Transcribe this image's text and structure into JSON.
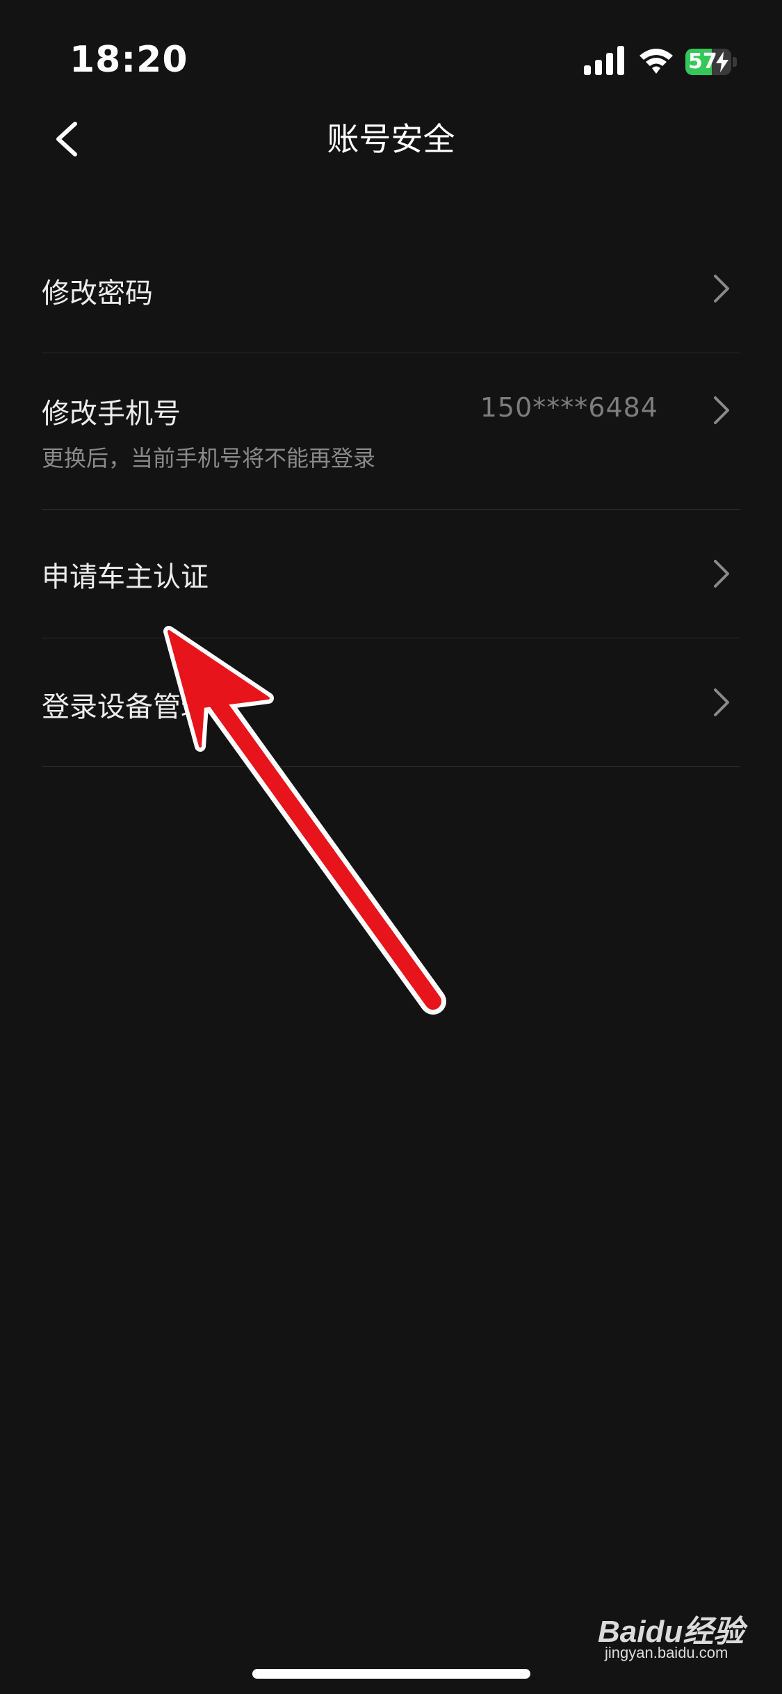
{
  "status_bar": {
    "time": "18:20",
    "battery_level": "57",
    "battery_fraction": 0.57,
    "battery_color": "#34c759",
    "icons": [
      "signal-icon",
      "wifi-icon",
      "battery-icon",
      "charging-bolt-icon"
    ]
  },
  "nav": {
    "back_icon": "chevron-left-icon",
    "title": "账号安全"
  },
  "settings": [
    {
      "title": "修改密码"
    },
    {
      "title": "修改手机号",
      "value": "150****6484",
      "subtitle": "更换后，当前手机号将不能再登录"
    },
    {
      "title": "申请车主认证"
    },
    {
      "title": "登录设备管理"
    }
  ],
  "annotation": {
    "arrow_color": "#e8141b",
    "icon": "red-arrow-pointer"
  },
  "watermark": {
    "main": "Baidu经验",
    "sub": "jingyan.baidu.com"
  },
  "theme": {
    "background": "#131313",
    "text_primary": "#ececec",
    "text_secondary": "#8a8a8a",
    "divider": "#2b2b2b"
  }
}
